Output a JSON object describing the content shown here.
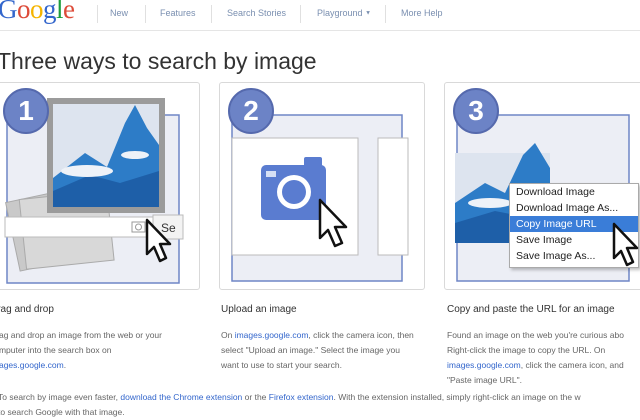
{
  "header": {
    "logo_letters": [
      "G",
      "o",
      "o",
      "g",
      "l",
      "e"
    ],
    "logo_colors": [
      "#3366cc",
      "#dd4b39",
      "#f5b400",
      "#3366cc",
      "#1e9e3e",
      "#dd4b39"
    ],
    "nav": [
      {
        "label": "New"
      },
      {
        "label": "Features"
      },
      {
        "label": "Search Stories"
      },
      {
        "label": "Playground",
        "has_dropdown": true
      },
      {
        "label": "More Help"
      }
    ]
  },
  "page_title": "Three ways to search by image",
  "steps": [
    {
      "number": "1",
      "title": "Drag and drop",
      "desc": [
        {
          "parts": [
            {
              "t": "Drag and drop an image from the web or your"
            }
          ]
        },
        {
          "parts": [
            {
              "t": "computer into the search box on"
            }
          ]
        },
        {
          "parts": [
            {
              "t": "images.google.com",
              "link": true
            },
            {
              "t": "."
            }
          ]
        }
      ],
      "search_button_label": "Se"
    },
    {
      "number": "2",
      "title": "Upload an image",
      "desc": [
        {
          "parts": [
            {
              "t": "On "
            },
            {
              "t": "images.google.com",
              "link": true
            },
            {
              "t": ", click the camera icon, then"
            }
          ]
        },
        {
          "parts": [
            {
              "t": "select \"Upload an image.\" Select the image you"
            }
          ]
        },
        {
          "parts": [
            {
              "t": "want to use to start your search."
            }
          ]
        }
      ]
    },
    {
      "number": "3",
      "title": "Copy and paste the URL for an image",
      "desc": [
        {
          "parts": [
            {
              "t": "Found an image on the web you're curious abo"
            }
          ]
        },
        {
          "parts": [
            {
              "t": "Right-click the image to copy the URL. On"
            }
          ]
        },
        {
          "parts": [
            {
              "t": "images.google.com",
              "link": true
            },
            {
              "t": ", click the camera icon, and"
            }
          ]
        },
        {
          "parts": [
            {
              "t": "\"Paste image URL\"."
            }
          ]
        }
      ],
      "context_menu": [
        {
          "label": "Download Image"
        },
        {
          "label": "Download Image As..."
        },
        {
          "label": "Copy Image URL",
          "selected": true
        },
        {
          "label": "Save Image"
        },
        {
          "label": "Save Image As..."
        }
      ]
    }
  ],
  "footer": [
    {
      "parts": [
        {
          "t": "To search by image even faster, "
        },
        {
          "t": "download the Chrome extension",
          "link": true
        },
        {
          "t": " or the "
        },
        {
          "t": "Firefox extension",
          "link": true
        },
        {
          "t": ". With the extension installed, simply right-click an image on the w"
        }
      ]
    },
    {
      "parts": [
        {
          "t": "to search Google with that image."
        }
      ]
    }
  ]
}
